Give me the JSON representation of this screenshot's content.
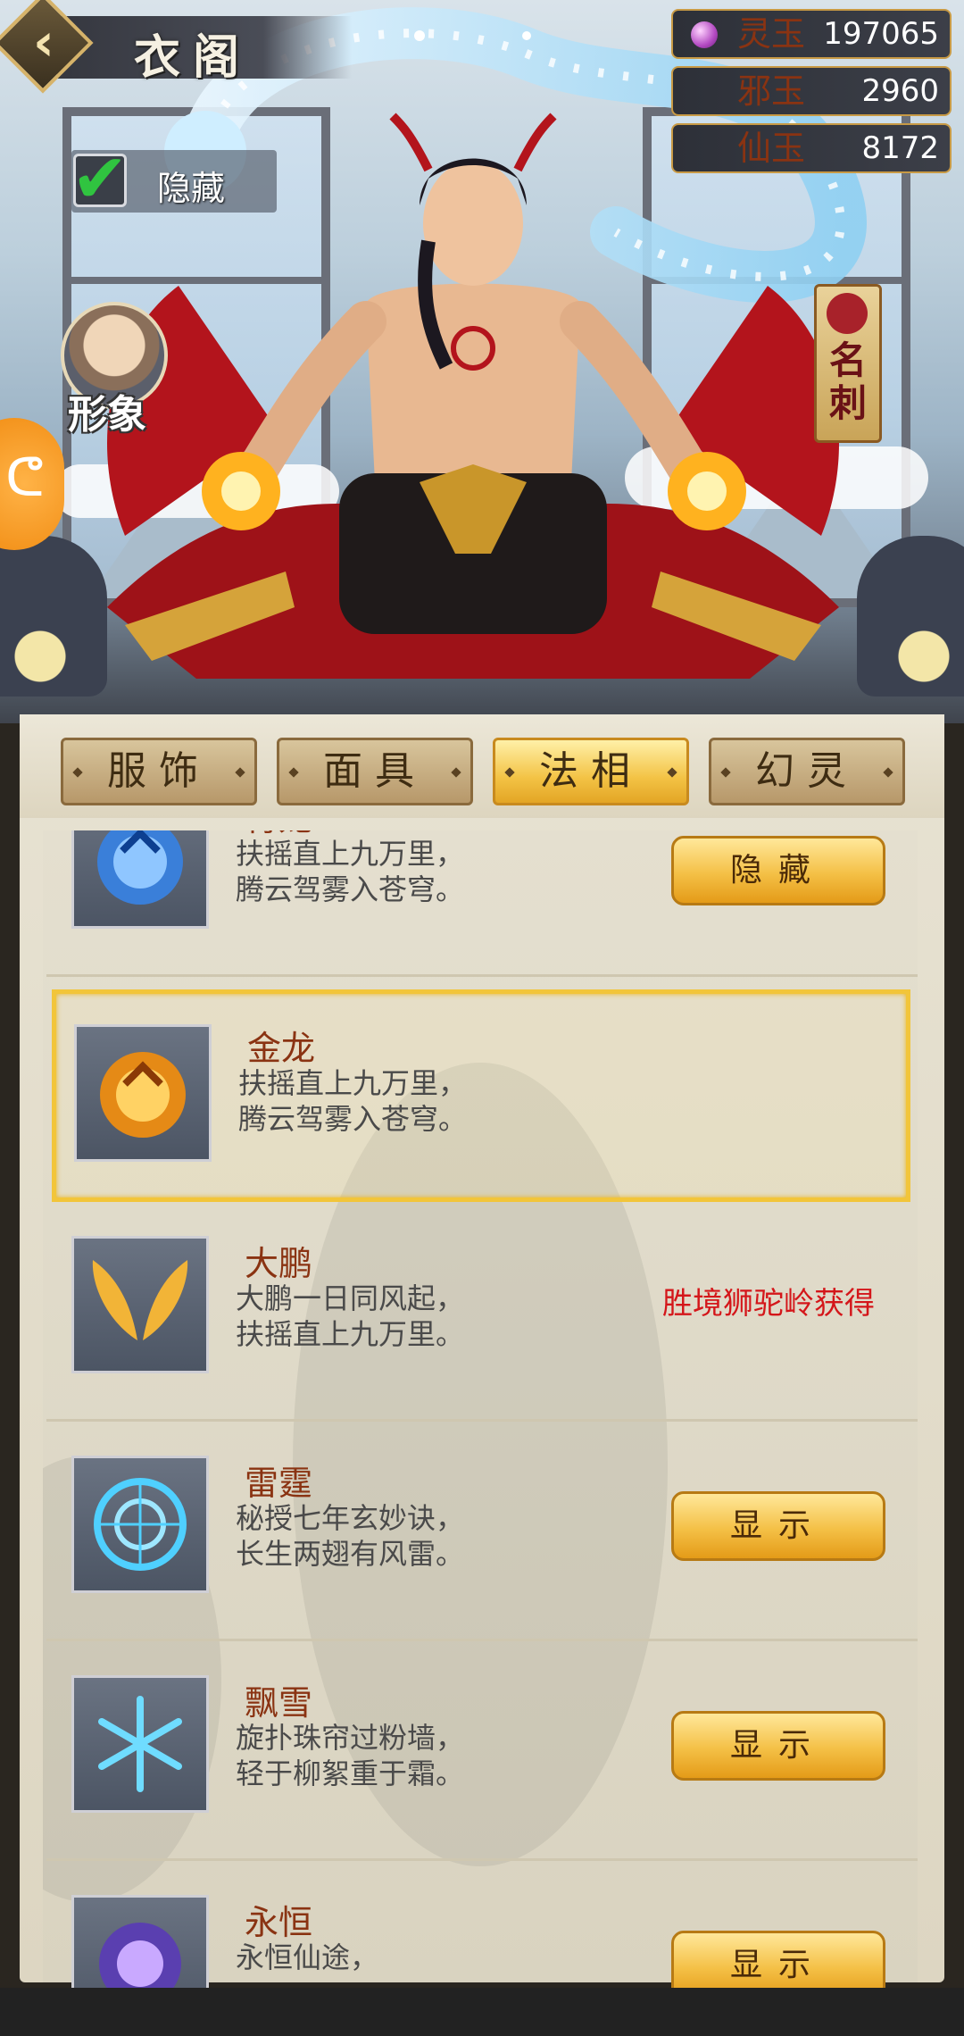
{
  "header": {
    "title": "衣阁",
    "back_icon": "chevron-left-icon"
  },
  "currencies": [
    {
      "name": "灵玉",
      "value": "197065",
      "icon": "gem-icon"
    },
    {
      "name": "邪玉",
      "value": "2960"
    },
    {
      "name": "仙玉",
      "value": "8172"
    }
  ],
  "hide_toggle": {
    "label": "隐藏",
    "checked": true
  },
  "side": {
    "image_button_label": "形象",
    "name_card_label": "名刺"
  },
  "tabs": [
    {
      "label": "服饰",
      "active": false
    },
    {
      "label": "面具",
      "active": false
    },
    {
      "label": "法相",
      "active": true
    },
    {
      "label": "幻灵",
      "active": false
    }
  ],
  "items": [
    {
      "name": "青龙",
      "desc": "扶摇直上九万里，\n腾云驾雾入苍穹。",
      "action": "隐藏",
      "icon": "blue-dragon-icon"
    },
    {
      "name": "金龙",
      "desc": "扶摇直上九万里，\n腾云驾雾入苍穹。",
      "selected": true,
      "icon": "gold-dragon-icon"
    },
    {
      "name": "大鹏",
      "desc": "大鹏一日同风起，\n扶摇直上九万里。",
      "obtain": "胜境狮驼岭获得",
      "icon": "golden-wings-icon"
    },
    {
      "name": "雷霆",
      "desc": "秘授七年玄妙诀，\n长生两翅有风雷。",
      "action": "显示",
      "icon": "thunder-circle-icon"
    },
    {
      "name": "飘雪",
      "desc": "旋扑珠帘过粉墙，\n轻于柳絮重于霜。",
      "action": "显示",
      "icon": "snowflake-icon"
    },
    {
      "name": "永恒",
      "desc": "永恒仙途，",
      "action": "显示",
      "icon": "eternal-orb-icon"
    }
  ],
  "colors": {
    "accent_gold": "#f2c53a",
    "obtain_red": "#d4161a",
    "name_brown": "#8a3312"
  }
}
